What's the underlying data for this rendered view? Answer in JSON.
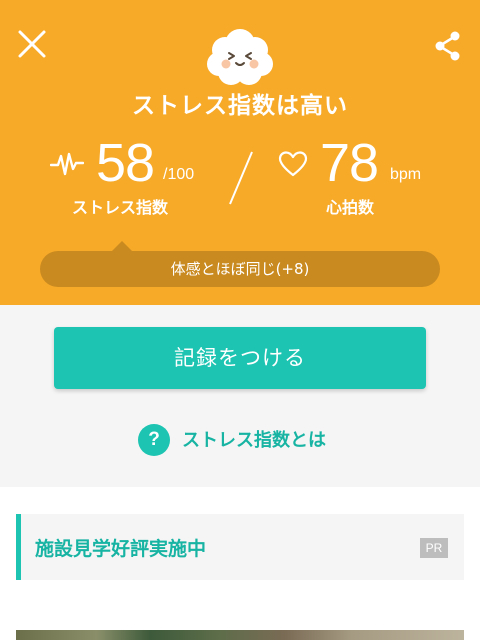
{
  "header": {
    "background_color": "#F7A928",
    "stress_status": "ストレス指数は高い",
    "close_icon": "close-x-icon",
    "share_icon": "share-icon",
    "mascot_icon": "happy-cloud-mascot-icon"
  },
  "stress": {
    "value": "58",
    "max": "/100",
    "label": "ストレス指数",
    "icon": "pulse-wave-icon"
  },
  "heart": {
    "value": "78",
    "unit": "bpm",
    "label": "心拍数",
    "icon": "heart-outline-icon"
  },
  "comparison": {
    "text": "体感とほぼ同じ(+8)",
    "color": "#C98A1F"
  },
  "actions": {
    "record_label": "記録をつける",
    "record_color": "#1CC4B1",
    "help_label": "ストレス指数とは",
    "help_icon_glyph": "?"
  },
  "promo": {
    "title": "施設見学好評実施中",
    "badge": "PR"
  }
}
